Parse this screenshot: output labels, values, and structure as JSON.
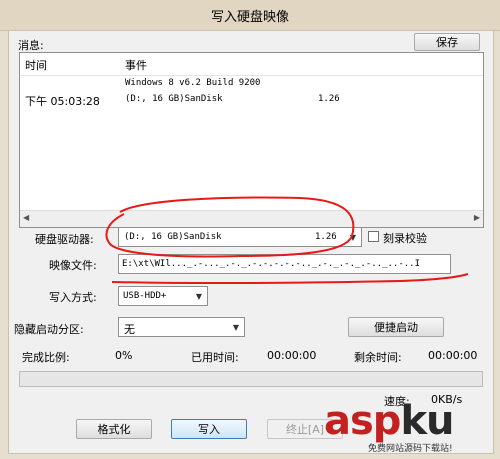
{
  "window": {
    "title": "写入硬盘映像"
  },
  "messages": {
    "label": "消息:",
    "save_label": "保存",
    "columns": {
      "time": "时间",
      "event": "事件"
    },
    "rows": [
      {
        "time": "",
        "event": "Windows 8 v6.2 Build 9200"
      },
      {
        "time": "下午 05:03:28",
        "event": "(D:, 16 GB)SanDisk",
        "extra": "1.26"
      }
    ]
  },
  "drive": {
    "label": "硬盘驱动器:",
    "value": "(D:, 16 GB)SanDisk",
    "extra": "1.26"
  },
  "verify": {
    "label": "刻录校验",
    "checked": false
  },
  "image_file": {
    "label": "映像文件:",
    "value": "E:\\xt\\WIl..._.-..._.-._.-.-.-.-.-.._.-._.-._.-.._..-..I"
  },
  "write_method": {
    "label": "写入方式:",
    "value": "USB-HDD+"
  },
  "hidden_partition": {
    "label": "隐藏启动分区:",
    "value": "无"
  },
  "boot_button": {
    "label": "便捷启动"
  },
  "stats": {
    "completed_label": "完成比例:",
    "completed_value": "0%",
    "elapsed_label": "已用时间:",
    "elapsed_value": "00:00:00",
    "remaining_label": "剩余时间:",
    "remaining_value": "00:00:00",
    "speed_label": "速度:",
    "speed_value": "0KB/s"
  },
  "progress": {
    "fraction": 0.0
  },
  "buttons": {
    "format": "格式化",
    "write": "写入",
    "stop": "终止[A]"
  },
  "watermark": {
    "main_a": "asp",
    "main_b": "ku",
    "sub": "免费网站源码下载站!"
  },
  "colors": {
    "accent": "#3c7fb1",
    "watermark": "#c32020"
  }
}
